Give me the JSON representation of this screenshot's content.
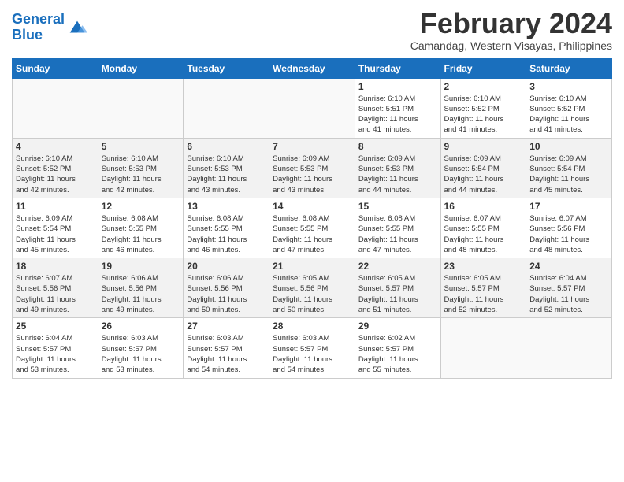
{
  "logo": {
    "line1": "General",
    "line2": "Blue"
  },
  "title": "February 2024",
  "subtitle": "Camandag, Western Visayas, Philippines",
  "header_days": [
    "Sunday",
    "Monday",
    "Tuesday",
    "Wednesday",
    "Thursday",
    "Friday",
    "Saturday"
  ],
  "weeks": [
    [
      {
        "day": "",
        "info": ""
      },
      {
        "day": "",
        "info": ""
      },
      {
        "day": "",
        "info": ""
      },
      {
        "day": "",
        "info": ""
      },
      {
        "day": "1",
        "info": "Sunrise: 6:10 AM\nSunset: 5:51 PM\nDaylight: 11 hours\nand 41 minutes."
      },
      {
        "day": "2",
        "info": "Sunrise: 6:10 AM\nSunset: 5:52 PM\nDaylight: 11 hours\nand 41 minutes."
      },
      {
        "day": "3",
        "info": "Sunrise: 6:10 AM\nSunset: 5:52 PM\nDaylight: 11 hours\nand 41 minutes."
      }
    ],
    [
      {
        "day": "4",
        "info": "Sunrise: 6:10 AM\nSunset: 5:52 PM\nDaylight: 11 hours\nand 42 minutes."
      },
      {
        "day": "5",
        "info": "Sunrise: 6:10 AM\nSunset: 5:53 PM\nDaylight: 11 hours\nand 42 minutes."
      },
      {
        "day": "6",
        "info": "Sunrise: 6:10 AM\nSunset: 5:53 PM\nDaylight: 11 hours\nand 43 minutes."
      },
      {
        "day": "7",
        "info": "Sunrise: 6:09 AM\nSunset: 5:53 PM\nDaylight: 11 hours\nand 43 minutes."
      },
      {
        "day": "8",
        "info": "Sunrise: 6:09 AM\nSunset: 5:53 PM\nDaylight: 11 hours\nand 44 minutes."
      },
      {
        "day": "9",
        "info": "Sunrise: 6:09 AM\nSunset: 5:54 PM\nDaylight: 11 hours\nand 44 minutes."
      },
      {
        "day": "10",
        "info": "Sunrise: 6:09 AM\nSunset: 5:54 PM\nDaylight: 11 hours\nand 45 minutes."
      }
    ],
    [
      {
        "day": "11",
        "info": "Sunrise: 6:09 AM\nSunset: 5:54 PM\nDaylight: 11 hours\nand 45 minutes."
      },
      {
        "day": "12",
        "info": "Sunrise: 6:08 AM\nSunset: 5:55 PM\nDaylight: 11 hours\nand 46 minutes."
      },
      {
        "day": "13",
        "info": "Sunrise: 6:08 AM\nSunset: 5:55 PM\nDaylight: 11 hours\nand 46 minutes."
      },
      {
        "day": "14",
        "info": "Sunrise: 6:08 AM\nSunset: 5:55 PM\nDaylight: 11 hours\nand 47 minutes."
      },
      {
        "day": "15",
        "info": "Sunrise: 6:08 AM\nSunset: 5:55 PM\nDaylight: 11 hours\nand 47 minutes."
      },
      {
        "day": "16",
        "info": "Sunrise: 6:07 AM\nSunset: 5:55 PM\nDaylight: 11 hours\nand 48 minutes."
      },
      {
        "day": "17",
        "info": "Sunrise: 6:07 AM\nSunset: 5:56 PM\nDaylight: 11 hours\nand 48 minutes."
      }
    ],
    [
      {
        "day": "18",
        "info": "Sunrise: 6:07 AM\nSunset: 5:56 PM\nDaylight: 11 hours\nand 49 minutes."
      },
      {
        "day": "19",
        "info": "Sunrise: 6:06 AM\nSunset: 5:56 PM\nDaylight: 11 hours\nand 49 minutes."
      },
      {
        "day": "20",
        "info": "Sunrise: 6:06 AM\nSunset: 5:56 PM\nDaylight: 11 hours\nand 50 minutes."
      },
      {
        "day": "21",
        "info": "Sunrise: 6:05 AM\nSunset: 5:56 PM\nDaylight: 11 hours\nand 50 minutes."
      },
      {
        "day": "22",
        "info": "Sunrise: 6:05 AM\nSunset: 5:57 PM\nDaylight: 11 hours\nand 51 minutes."
      },
      {
        "day": "23",
        "info": "Sunrise: 6:05 AM\nSunset: 5:57 PM\nDaylight: 11 hours\nand 52 minutes."
      },
      {
        "day": "24",
        "info": "Sunrise: 6:04 AM\nSunset: 5:57 PM\nDaylight: 11 hours\nand 52 minutes."
      }
    ],
    [
      {
        "day": "25",
        "info": "Sunrise: 6:04 AM\nSunset: 5:57 PM\nDaylight: 11 hours\nand 53 minutes."
      },
      {
        "day": "26",
        "info": "Sunrise: 6:03 AM\nSunset: 5:57 PM\nDaylight: 11 hours\nand 53 minutes."
      },
      {
        "day": "27",
        "info": "Sunrise: 6:03 AM\nSunset: 5:57 PM\nDaylight: 11 hours\nand 54 minutes."
      },
      {
        "day": "28",
        "info": "Sunrise: 6:03 AM\nSunset: 5:57 PM\nDaylight: 11 hours\nand 54 minutes."
      },
      {
        "day": "29",
        "info": "Sunrise: 6:02 AM\nSunset: 5:57 PM\nDaylight: 11 hours\nand 55 minutes."
      },
      {
        "day": "",
        "info": ""
      },
      {
        "day": "",
        "info": ""
      }
    ]
  ]
}
